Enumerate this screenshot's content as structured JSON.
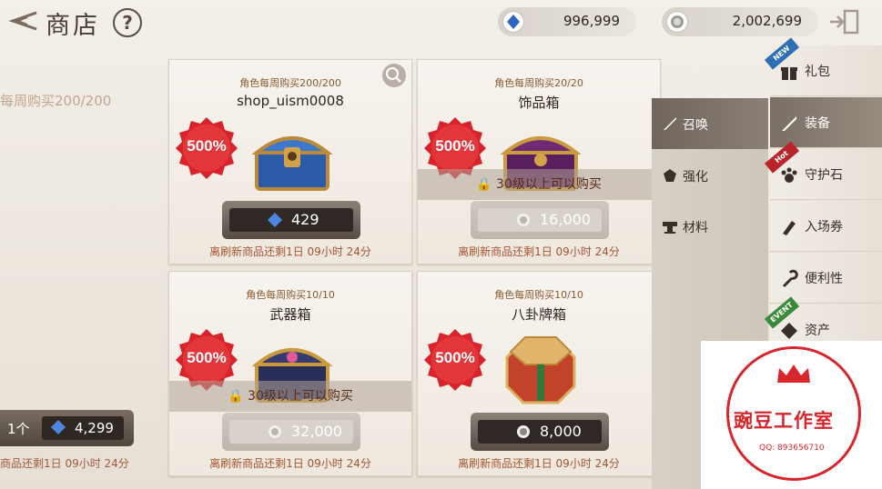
{
  "header": {
    "title": "商店",
    "help": "?",
    "currency": [
      {
        "icon": "blue-gem-icon",
        "value": "996,999"
      },
      {
        "icon": "silver-coin-icon",
        "value": "2,002,699"
      }
    ]
  },
  "left_partial": {
    "limit_text": "每周购买200/200",
    "count": "1个",
    "price": "4,299",
    "timer": "商品还剩1日 09小时 24分"
  },
  "cards": [
    {
      "limit": "角色每周购买200/200",
      "name": "shop_uism0008",
      "badge": "500%",
      "price": "429",
      "currency": "blue-gem-icon",
      "timer": "离刷新商品还剩1日 09小时 24分",
      "locked": false
    },
    {
      "limit": "角色每周购买20/20",
      "name": "饰品箱",
      "badge": "500%",
      "price": "16,000",
      "currency": "silver-coin-icon",
      "timer": "离刷新商品还剩1日 09小时 24分",
      "locked": true,
      "lock_text": "30级以上可以购买"
    },
    {
      "limit": "角色每周购买10/10",
      "name": "武器箱",
      "badge": "500%",
      "price": "32,000",
      "currency": "silver-coin-icon",
      "timer": "离刷新商品还剩1日 09小时 24分",
      "locked": true,
      "lock_text": "30级以上可以购买"
    },
    {
      "limit": "角色每周购买10/10",
      "name": "八卦牌箱",
      "badge": "500%",
      "price": "8,000",
      "currency": "silver-coin-icon",
      "timer": "离刷新商品还剩1日 09小时 24分",
      "locked": false
    }
  ],
  "submenu": [
    {
      "label": "召唤",
      "icon": "sword-icon",
      "active": true
    },
    {
      "label": "强化",
      "icon": "stone-icon",
      "active": false
    },
    {
      "label": "材料",
      "icon": "anvil-icon",
      "active": false
    }
  ],
  "tabs": [
    {
      "label": "礼包",
      "icon": "gift-icon",
      "ribbon": "NEW",
      "ribbon_color": "#2c6fb3"
    },
    {
      "label": "装备",
      "icon": "sword-icon",
      "active": true
    },
    {
      "label": "守护石",
      "icon": "paw-icon",
      "ribbon": "Hot",
      "ribbon_color": "#b8262c"
    },
    {
      "label": "入场券",
      "icon": "ticket-icon"
    },
    {
      "label": "便利性",
      "icon": "wrench-icon"
    },
    {
      "label": "资产",
      "icon": "diamond-icon",
      "ribbon": "EVENT",
      "ribbon_color": "#3a8a3a"
    }
  ],
  "watermark": {
    "text": "豌豆工作室",
    "qq": "QQ: 893656710"
  }
}
